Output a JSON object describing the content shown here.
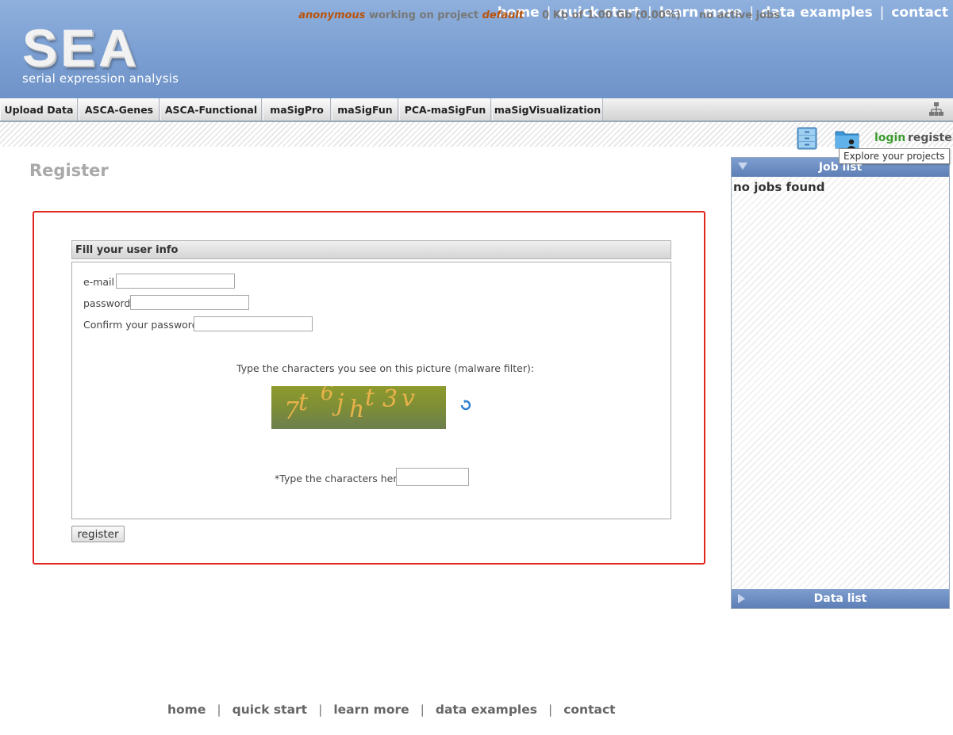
{
  "header": {
    "logo_title": "SEA",
    "logo_subtitle": "serial expression analysis",
    "nav": [
      "home",
      "quick start",
      "learn more",
      "data examples",
      "contact"
    ]
  },
  "tabs": [
    "Upload Data",
    "ASCA-Genes",
    "ASCA-Functional",
    "maSigPro",
    "maSigFun",
    "PCA-maSigFun",
    "maSigVisualization"
  ],
  "status": {
    "user": "anonymous",
    "working_text": "working on project",
    "project": "default",
    "quota": "0 Kb of 1.00 Gb (0.00%)",
    "jobs": "no active jobs",
    "login": "login",
    "register": "register",
    "tooltip": "Explore your projects"
  },
  "page": {
    "title": "Register"
  },
  "form": {
    "legend": "Fill your user info",
    "email_label": "e-mail",
    "password_label": "password",
    "confirm_label": "Confirm your password",
    "email_value": "",
    "password_value": "",
    "confirm_value": "",
    "captcha_prompt": "Type the characters you see on this picture (malware filter):",
    "captcha_chars": [
      "7",
      "t",
      "6",
      "j",
      "h",
      "t",
      "3",
      "v"
    ],
    "captcha_label": "*Type the characters here:",
    "captcha_value": "",
    "submit": "register"
  },
  "sidebar": {
    "job_list": "Job list",
    "no_jobs": "no jobs found",
    "data_list": "Data list"
  },
  "footer": {
    "nav": [
      "home",
      "quick start",
      "learn more",
      "data examples",
      "contact"
    ]
  },
  "colors": {
    "header_blue": "#7b9fd2",
    "accent_orange": "#b8540e",
    "login_green": "#3c9d2f",
    "highlight_red": "#e0271d"
  }
}
